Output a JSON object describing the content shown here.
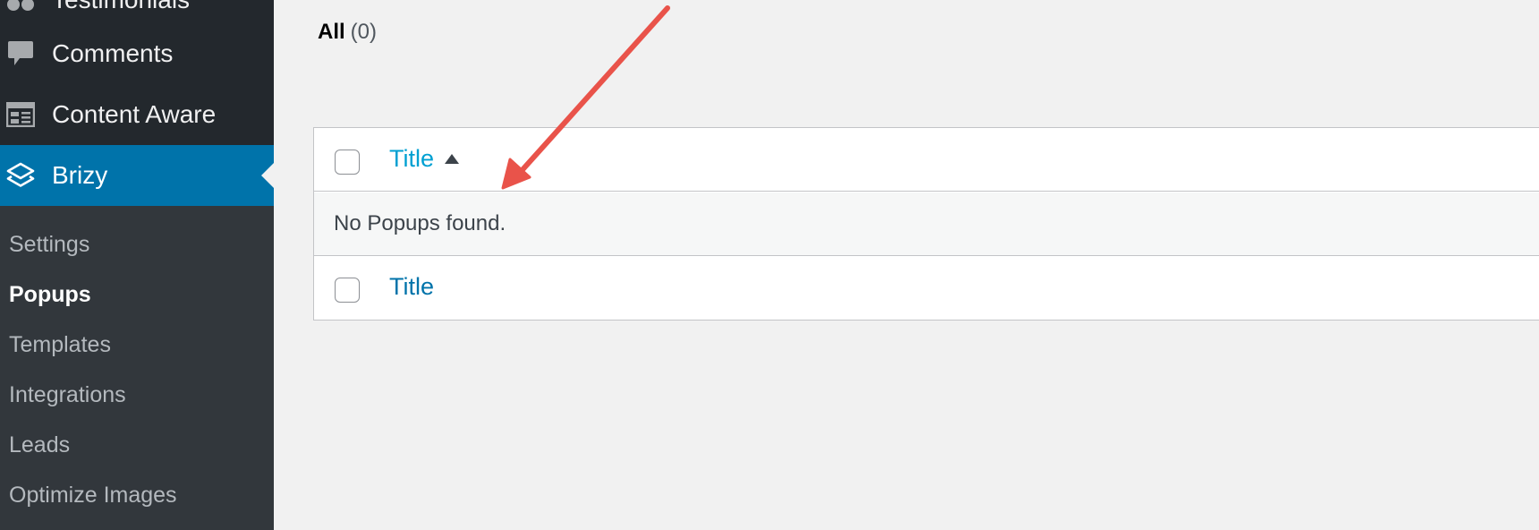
{
  "sidebar": {
    "partial_item": {
      "label": "Testimonials",
      "icon": "testimonials-icon"
    },
    "items": [
      {
        "label": "Comments",
        "icon": "comment-bubble-icon"
      },
      {
        "label": "Content Aware",
        "icon": "layout-grid-icon"
      },
      {
        "label": "Brizy",
        "icon": "brizy-layers-icon",
        "active": true
      }
    ],
    "submenu": [
      {
        "label": "Settings"
      },
      {
        "label": "Popups",
        "current": true
      },
      {
        "label": "Templates"
      },
      {
        "label": "Integrations"
      },
      {
        "label": "Leads"
      },
      {
        "label": "Optimize Images"
      }
    ],
    "colors": {
      "background": "#23282d",
      "submenu_background": "#32373c",
      "active": "#0073aa"
    }
  },
  "main": {
    "filter": {
      "label": "All",
      "count": "(0)"
    },
    "table": {
      "header_title": "Title",
      "empty_message": "No Popups found.",
      "footer_title": "Title",
      "sort": "ascending"
    },
    "link_color": "#0073aa"
  },
  "annotation": {
    "type": "arrow",
    "color": "#e9534a"
  }
}
